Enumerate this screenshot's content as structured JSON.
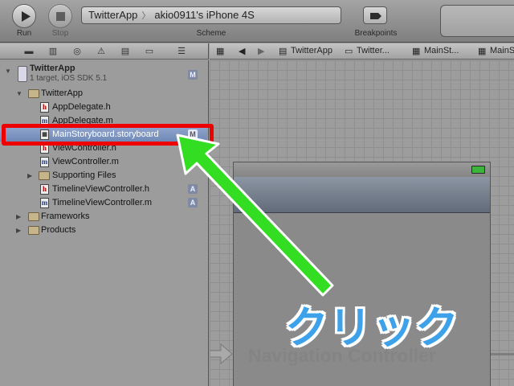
{
  "toolbar": {
    "run_label": "Run",
    "stop_label": "Stop",
    "scheme": {
      "target": "TwitterApp",
      "device": "akio0911's iPhone 4S",
      "label": "Scheme"
    },
    "breakpoints_label": "Breakpoints"
  },
  "navigator": {
    "project": {
      "name": "TwitterApp",
      "subtitle": "1 target, iOS SDK 5.1",
      "badge": "M"
    },
    "items": [
      {
        "label": "TwitterApp",
        "icon": "folder-icon",
        "badge": ""
      },
      {
        "label": "AppDelegate.h",
        "icon": "header-file-icon",
        "badge": ""
      },
      {
        "label": "AppDelegate.m",
        "icon": "implementation-file-icon",
        "badge": ""
      },
      {
        "label": "MainStoryboard.storyboard",
        "icon": "storyboard-file-icon",
        "badge": "M",
        "selected": true
      },
      {
        "label": "ViewController.h",
        "icon": "header-file-icon",
        "badge": ""
      },
      {
        "label": "ViewController.m",
        "icon": "implementation-file-icon",
        "badge": ""
      },
      {
        "label": "Supporting Files",
        "icon": "folder-icon",
        "badge": ""
      },
      {
        "label": "TimelineViewController.h",
        "icon": "header-file-icon",
        "badge": "A"
      },
      {
        "label": "TimelineViewController.m",
        "icon": "implementation-file-icon",
        "badge": "A"
      },
      {
        "label": "Frameworks",
        "icon": "folder-icon",
        "badge": ""
      },
      {
        "label": "Products",
        "icon": "folder-icon",
        "badge": ""
      }
    ]
  },
  "jumpbar": {
    "crumbs": [
      "TwitterApp",
      "Twitter...",
      "MainSt...",
      "MainSt"
    ]
  },
  "canvas": {
    "scene_label": "Navigation Controller"
  },
  "annotation": {
    "text": "クリック",
    "colors": {
      "arrow": "#33dd22",
      "highlight": "#ee0000",
      "text": "#3ea2ea"
    }
  }
}
